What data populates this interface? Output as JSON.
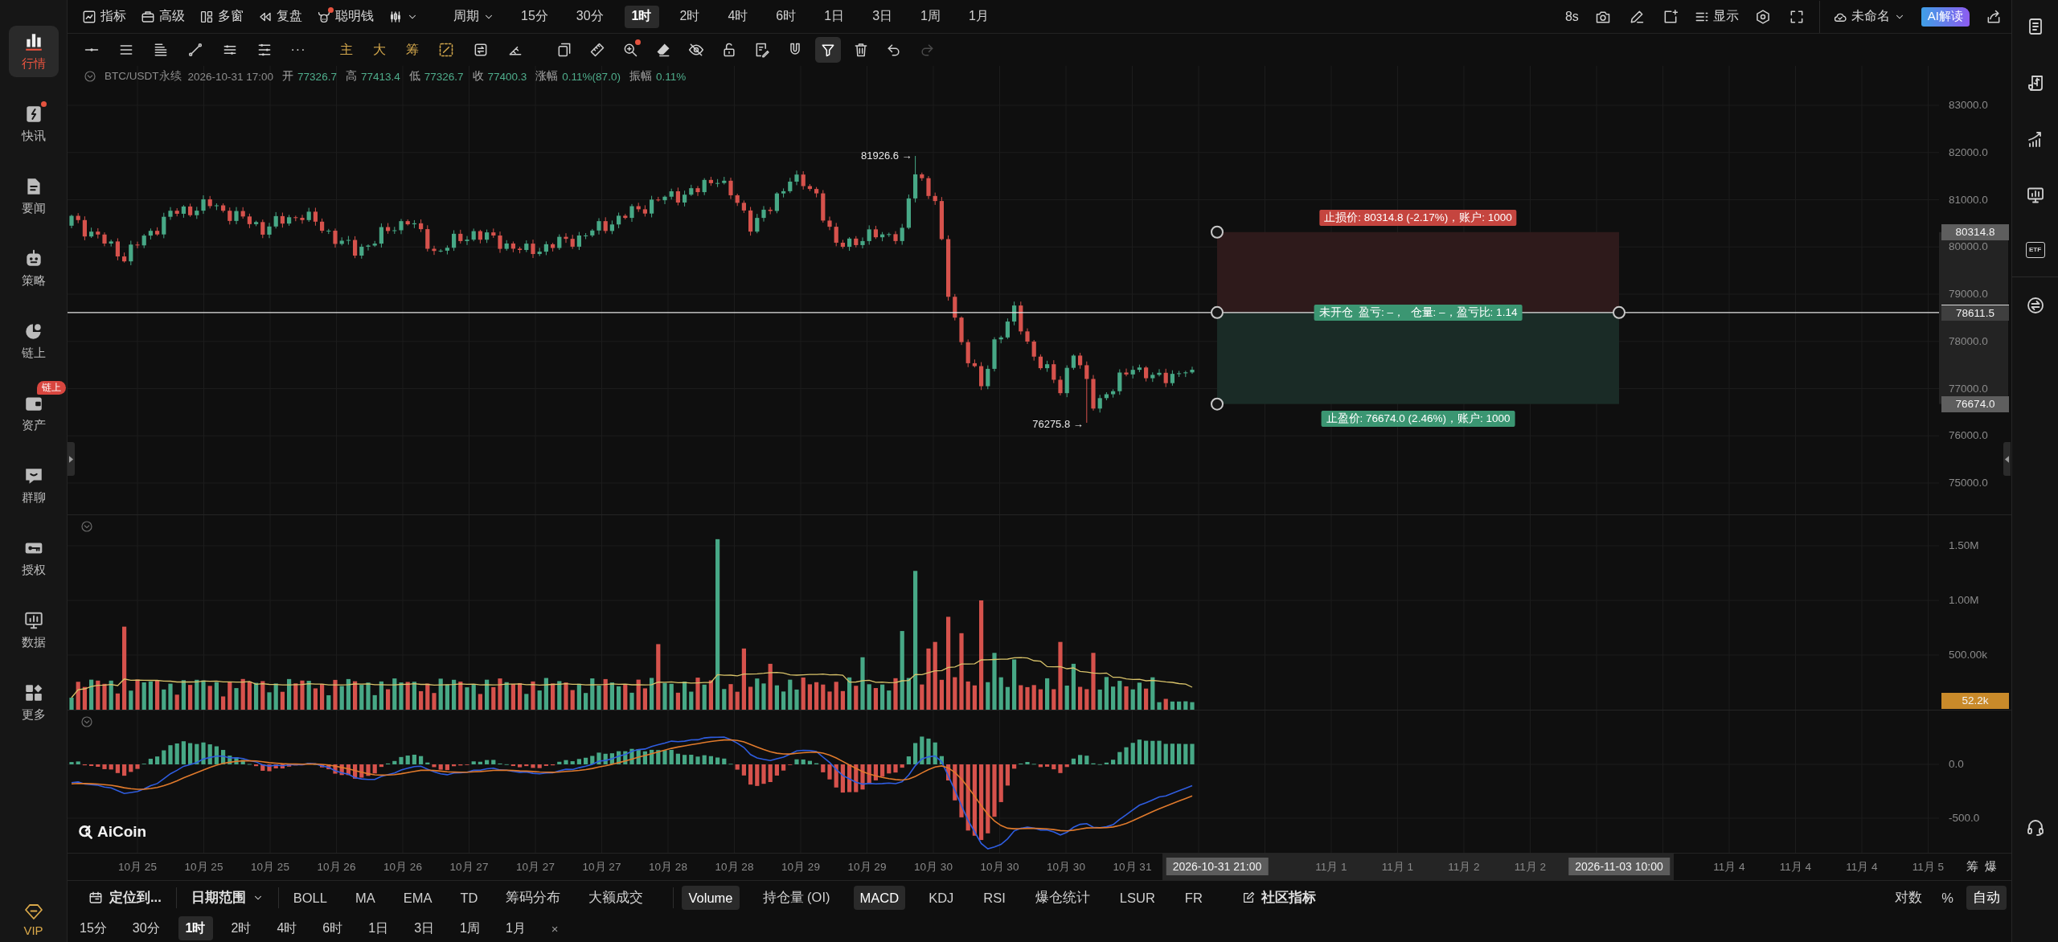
{
  "sidebar": {
    "items": [
      {
        "label": "行情",
        "selected": true,
        "unread": false
      },
      {
        "label": "快讯",
        "selected": false,
        "unread": true
      },
      {
        "label": "要闻",
        "selected": false,
        "unread": false
      },
      {
        "label": "策略",
        "selected": false,
        "unread": false
      },
      {
        "label": "链上",
        "selected": false,
        "unread": false
      },
      {
        "label": "资产",
        "selected": false,
        "unread": false,
        "badge": "链上"
      },
      {
        "label": "群聊",
        "selected": false,
        "unread": false
      },
      {
        "label": "授权",
        "selected": false,
        "unread": false
      },
      {
        "label": "数据",
        "selected": false,
        "unread": false
      },
      {
        "label": "更多",
        "selected": false,
        "unread": false
      }
    ],
    "vip": "VIP"
  },
  "top_bar": {
    "tools": [
      {
        "label": "指标",
        "unread": false
      },
      {
        "label": "高级",
        "unread": false
      },
      {
        "label": "多窗",
        "unread": false
      },
      {
        "label": "复盘",
        "unread": false
      },
      {
        "label": "聪明钱",
        "unread": true
      }
    ],
    "period_menu": "周期",
    "periods": [
      {
        "label": "15分",
        "selected": false
      },
      {
        "label": "30分",
        "selected": false
      },
      {
        "label": "1时",
        "selected": true
      },
      {
        "label": "2时",
        "selected": false
      },
      {
        "label": "4时",
        "selected": false
      },
      {
        "label": "6时",
        "selected": false
      },
      {
        "label": "1日",
        "selected": false
      },
      {
        "label": "3日",
        "selected": false
      },
      {
        "label": "1周",
        "selected": false
      },
      {
        "label": "1月",
        "selected": false
      }
    ],
    "refresh_interval": "8s",
    "display_menu": "显示",
    "layout_name": "未命名",
    "ai_button": "AI解读"
  },
  "drawing_toolbar": {
    "more": "···",
    "overlays": [
      "主",
      "大",
      "筹"
    ],
    "tools": [
      {
        "selected": false,
        "disabled": false,
        "unread": false
      },
      {
        "selected": false,
        "disabled": false,
        "unread": false
      },
      {
        "selected": false,
        "disabled": false,
        "unread": true
      },
      {
        "selected": false,
        "disabled": false,
        "unread": false
      },
      {
        "selected": false,
        "disabled": false,
        "unread": false
      },
      {
        "selected": false,
        "disabled": false,
        "unread": false
      },
      {
        "selected": false,
        "disabled": false,
        "unread": false
      },
      {
        "selected": false,
        "disabled": false,
        "unread": false
      },
      {
        "selected": true,
        "disabled": false,
        "unread": false
      },
      {
        "selected": false,
        "disabled": false,
        "unread": false
      },
      {
        "selected": false,
        "disabled": false,
        "unread": false
      },
      {
        "selected": false,
        "disabled": true,
        "unread": false
      }
    ]
  },
  "legend": {
    "symbol": "BTC/USDT永续",
    "time": "2026-10-31 17:00",
    "fields": [
      {
        "label": "开",
        "value": "77326.7"
      },
      {
        "label": "高",
        "value": "77413.4"
      },
      {
        "label": "低",
        "value": "77326.7"
      },
      {
        "label": "收",
        "value": "77400.3"
      },
      {
        "label": "涨幅",
        "value": "0.11%(87.0)"
      },
      {
        "label": "振幅",
        "value": "0.11%"
      }
    ]
  },
  "price_chart": {
    "price_ticks": [
      "83000.0",
      "82000.0",
      "81000.0",
      "80000.0",
      "79000.0",
      "78000.0",
      "77000.0",
      "76000.0",
      "75000.0"
    ],
    "high_marker": "81926.6 →",
    "low_marker": "76275.8 →",
    "position_tool": {
      "stop_loss_label": "止损价: 80314.8 (-2.17%)，账户: 1000",
      "entry_label": "未开仓  盈亏: –，  仓量: –，盈亏比: 1.14",
      "take_profit_label": "止盈价: 76674.0 (2.46%)，账户: 1000",
      "stop_loss_tag": "80314.8",
      "entry_tag": "78611.5",
      "take_profit_tag": "76674.0"
    }
  },
  "volume_pane": {
    "ticks": [
      "1.50M",
      "1.00M",
      "500.00k"
    ],
    "last_value": "52.2k"
  },
  "macd_pane": {
    "ticks": [
      "0.0",
      "-500.0"
    ],
    "brand_logo": "AiCoin"
  },
  "time_axis": {
    "labels_before_range": [
      "10月 25",
      "10月 25",
      "10月 25",
      "10月 26",
      "10月 26",
      "10月 27",
      "10月 27",
      "10月 27",
      "10月 28",
      "10月 28",
      "10月 29",
      "10月 29",
      "10月 30",
      "10月 30",
      "10月 30",
      "10月 31"
    ],
    "range_start": "2026-10-31 21:00",
    "labels_in_range": [
      "11月 1",
      "11月 1",
      "11月 2",
      "11月 2"
    ],
    "range_end": "2026-11-03 10:00",
    "labels_after_range": [
      "11月 4",
      "11月 4",
      "11月 4",
      "11月 5"
    ],
    "toggles": [
      "筹",
      "爆"
    ]
  },
  "indicator_bar": {
    "locate": "定位到...",
    "date_range": "日期范围",
    "main_indicators": [
      {
        "label": "BOLL",
        "selected": false
      },
      {
        "label": "MA",
        "selected": false
      },
      {
        "label": "EMA",
        "selected": false
      },
      {
        "label": "TD",
        "selected": false
      },
      {
        "label": "筹码分布",
        "selected": false
      },
      {
        "label": "大额成交",
        "selected": false
      }
    ],
    "sub_indicators": [
      {
        "label": "Volume",
        "selected": true
      },
      {
        "label": "持仓量 (OI)",
        "selected": false
      },
      {
        "label": "MACD",
        "selected": true
      },
      {
        "label": "KDJ",
        "selected": false
      },
      {
        "label": "RSI",
        "selected": false
      },
      {
        "label": "爆仓统计",
        "selected": false
      },
      {
        "label": "LSUR",
        "selected": false
      },
      {
        "label": "FR",
        "selected": false
      }
    ],
    "community": "社区指标",
    "scale_modes": [
      {
        "label": "对数",
        "selected": false
      },
      {
        "label": "%",
        "selected": false
      },
      {
        "label": "自动",
        "selected": true
      }
    ]
  },
  "period_bar": {
    "periods": [
      {
        "label": "15分",
        "selected": false
      },
      {
        "label": "30分",
        "selected": false
      },
      {
        "label": "1时",
        "selected": true
      },
      {
        "label": "2时",
        "selected": false
      },
      {
        "label": "4时",
        "selected": false
      },
      {
        "label": "6时",
        "selected": false
      },
      {
        "label": "1日",
        "selected": false
      },
      {
        "label": "3日",
        "selected": false
      },
      {
        "label": "1周",
        "selected": false
      },
      {
        "label": "1月",
        "selected": false
      }
    ],
    "close": "×"
  },
  "right_sidebar": {
    "etf_label": "ETF"
  }
}
